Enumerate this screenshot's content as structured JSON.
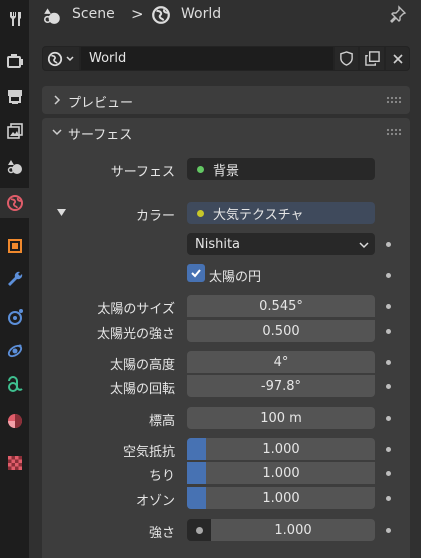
{
  "colors": {
    "background": "#303030",
    "tab_bar": "#1d1d1d",
    "panel": "#3d3d3d",
    "field": "#545454",
    "accent": "#4772b3",
    "shader_socket": "#63c763",
    "color_socket": "#c7c729"
  },
  "sidebar": {
    "tabs": [
      {
        "icon": "tool-icon",
        "active": false
      },
      {
        "icon": "render-icon",
        "active": false
      },
      {
        "icon": "output-icon",
        "active": false
      },
      {
        "icon": "view-layer-icon",
        "active": false
      },
      {
        "icon": "scene-icon",
        "active": false
      },
      {
        "icon": "world-icon",
        "active": true
      },
      {
        "icon": "object-icon",
        "active": false
      },
      {
        "icon": "modifier-icon",
        "active": false
      },
      {
        "icon": "particles-icon",
        "active": false
      },
      {
        "icon": "physics-icon",
        "active": false
      },
      {
        "icon": "constraint-icon",
        "active": false
      },
      {
        "icon": "data-icon",
        "active": false
      },
      {
        "icon": "material-icon",
        "active": false
      },
      {
        "icon": "texture-icon",
        "active": false
      }
    ]
  },
  "header": {
    "scene_label": "Scene",
    "separator": ">",
    "world_label": "World",
    "pin_icon": "pin-icon"
  },
  "datablock": {
    "name": "World"
  },
  "panels": {
    "preview": {
      "title": "プレビュー",
      "expanded": false
    },
    "surface": {
      "title": "サーフェス",
      "expanded": true
    }
  },
  "surface": {
    "surface_label": "サーフェス",
    "surface_value": "背景",
    "color_label": "カラー",
    "color_value": "大気テクスチャ",
    "sky_type": "Nishita",
    "sun_disc_label": "太陽の円",
    "sun_disc_checked": true,
    "props": [
      {
        "label": "太陽のサイズ",
        "value": "0.545°"
      },
      {
        "label": "太陽光の強さ",
        "value": "0.500"
      },
      {
        "label": "太陽の高度",
        "value": "4°"
      },
      {
        "label": "太陽の回転",
        "value": "-97.8°"
      },
      {
        "label": "標高",
        "value": "100 m"
      },
      {
        "label": "空気抵抗",
        "value": "1.000",
        "fill": 0.1
      },
      {
        "label": "ちり",
        "value": "1.000",
        "fill": 0.1
      },
      {
        "label": "オゾン",
        "value": "1.000",
        "fill": 0.1
      }
    ],
    "strength_label": "強さ",
    "strength_value": "1.000"
  }
}
